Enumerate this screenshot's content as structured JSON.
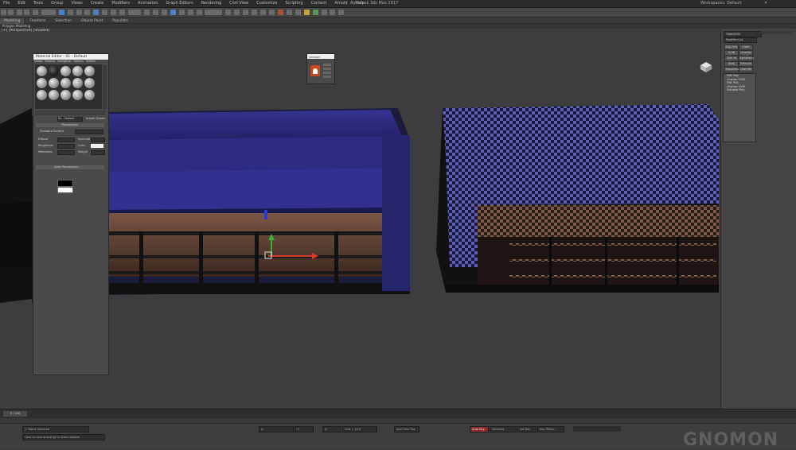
{
  "menubar": {
    "items": [
      "File",
      "Edit",
      "Tools",
      "Group",
      "Views",
      "Create",
      "Modifiers",
      "Animation",
      "Graph Editors",
      "Rendering",
      "Civil View",
      "Customize",
      "Scripting",
      "Content",
      "Arnold",
      "Help"
    ],
    "workspace": "Workspaces: Default",
    "app_title": "Autodesk 3ds Max 2017",
    "signin": "Sign In"
  },
  "ribbon": {
    "tabs": [
      "Modeling",
      "Freeform",
      "Selection",
      "Object Paint",
      "Populate"
    ],
    "active_subtab": "Polygon Modeling"
  },
  "viewport": {
    "label": "[+] [Perspective] [Shaded]"
  },
  "command_panel": {
    "object_name": "Object002",
    "modifier_list_label": "Modifier List",
    "buttons": [
      "Edit Poly",
      "Cloth",
      "UVW Map",
      "Unwrap UVW",
      "Turn to Poly",
      "Symmetry",
      "Shell",
      "Extrude",
      "TurboSmooth",
      "Chamfer"
    ],
    "stack": [
      "Edit Poly",
      "Unwrap UVW",
      "Edit Poly",
      "Unwrap UVW",
      "Editable Poly"
    ]
  },
  "material_editor": {
    "title": "Material Editor - 01 - Default",
    "menu": [
      "Modes",
      "Material",
      "Navigation",
      "Options",
      "Utilities"
    ],
    "material_name": "01 - Default",
    "material_type": "Arnold Shader",
    "rollout_title": "Parameters",
    "shader_label": "Standard Surface",
    "params": [
      "Diffuse",
      "Roughness",
      "Metalness",
      "Specular",
      "Color",
      "Weight"
    ],
    "bottom_title": "Color Parameters"
  },
  "mini_dialog": {
    "title": "Viewport"
  },
  "status": {
    "selection": "1 Object Selected",
    "prompt": "Click or click-and-drag to select objects",
    "time": "0 / 100",
    "coord_x": "X:",
    "coord_y": "Y:",
    "coord_z": "Z:",
    "grid": "Grid = 10.0",
    "autokey": "Auto Key",
    "setkey": "Set Key",
    "selected": "Selected",
    "keyfilters": "Key Filters...",
    "add_time_tag": "Add Time Tag",
    "watermark": "GNOMON"
  },
  "colors": {
    "viewport_bg": "#3d3d3d",
    "model_blue": "#2c2a7a",
    "checker_dark": "#1a1a3a",
    "checker_light": "#5f5fb8",
    "interior_brown": "#6e4a3a",
    "gizmo_red": "#d63a2a",
    "gizmo_green": "#3ab03a",
    "gizmo_blue": "#2a3ad6"
  }
}
